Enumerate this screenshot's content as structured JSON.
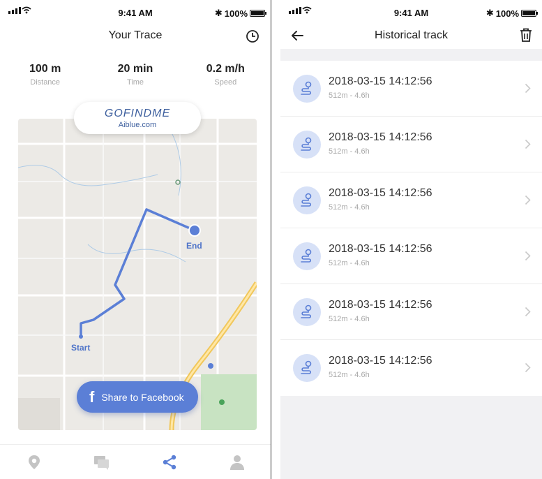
{
  "status": {
    "time": "9:41 AM",
    "battery": "100%"
  },
  "trace": {
    "title": "Your Trace",
    "stats": [
      {
        "value": "100 m",
        "label": "Distance"
      },
      {
        "value": "20 min",
        "label": "Time"
      },
      {
        "value": "0.2 m/h",
        "label": "Speed"
      }
    ],
    "brand": {
      "logo": "GOFINDME",
      "site": "Aiblue.com"
    },
    "map": {
      "start_label": "Start",
      "end_label": "End",
      "route_color": "#5b7fd6"
    },
    "share_label": "Share to Facebook",
    "tabs": [
      {
        "icon": "location-pin-icon",
        "active": false
      },
      {
        "icon": "chat-icon",
        "active": false
      },
      {
        "icon": "share-icon",
        "active": true
      },
      {
        "icon": "person-icon",
        "active": false
      }
    ]
  },
  "history": {
    "title": "Historical track",
    "items": [
      {
        "date": "2018-03-15 14:12:56",
        "meta": "512m - 4.6h"
      },
      {
        "date": "2018-03-15 14:12:56",
        "meta": "512m - 4.6h"
      },
      {
        "date": "2018-03-15 14:12:56",
        "meta": "512m - 4.6h"
      },
      {
        "date": "2018-03-15 14:12:56",
        "meta": "512m - 4.6h"
      },
      {
        "date": "2018-03-15 14:12:56",
        "meta": "512m - 4.6h"
      },
      {
        "date": "2018-03-15 14:12:56",
        "meta": "512m - 4.6h"
      }
    ]
  },
  "colors": {
    "accent": "#5b7fd6",
    "badge_bg": "#d7e1f7",
    "inactive_icon": "#c4c4c4"
  }
}
